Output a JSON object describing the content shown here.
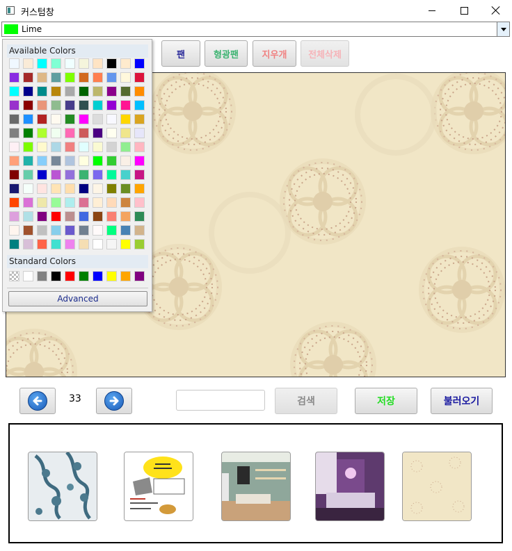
{
  "window": {
    "title": "커스텀창"
  },
  "color_combo": {
    "selected": "Lime",
    "swatch": "#00ff00"
  },
  "toolbar": {
    "pen": "팬",
    "highlighter": "형광팬",
    "eraser": "지우개",
    "clear_all": "전체삭제"
  },
  "color_picker": {
    "available_label": "Available Colors",
    "standard_label": "Standard Colors",
    "advanced_label": "Advanced",
    "available": [
      "#f0f8ff",
      "#faebd7",
      "#00ffff",
      "#7fffd4",
      "#f0ffff",
      "#f5f5dc",
      "#ffe4c4",
      "#000000",
      "#ffebcd",
      "#0000ff",
      "#8a2be2",
      "#a52a2a",
      "#deb887",
      "#5f9ea0",
      "#7fff00",
      "#d2691e",
      "#ff7f50",
      "#6495ed",
      "#fff8dc",
      "#dc143c",
      "#00ffff",
      "#00008b",
      "#008b8b",
      "#b8860b",
      "#a9a9a9",
      "#006400",
      "#bdb76b",
      "#8b008b",
      "#556b2f",
      "#ff8c00",
      "#9932cc",
      "#8b0000",
      "#e9967a",
      "#8fbc8f",
      "#483d8b",
      "#2f4f4f",
      "#00ced1",
      "#9400d3",
      "#ff1493",
      "#00bfff",
      "#696969",
      "#1e90ff",
      "#b22222",
      "#fffaf0",
      "#228b22",
      "#ff00ff",
      "#dcdcdc",
      "#f8f8ff",
      "#ffd700",
      "#daa520",
      "#808080",
      "#008000",
      "#adff2f",
      "#f0fff0",
      "#ff69b4",
      "#cd5c5c",
      "#4b0082",
      "#fffff0",
      "#f0e68c",
      "#e6e6fa",
      "#fff0f5",
      "#7cfc00",
      "#fffacd",
      "#add8e6",
      "#f08080",
      "#e0ffff",
      "#fafad2",
      "#d3d3d3",
      "#90ee90",
      "#ffb6c1",
      "#ffa07a",
      "#20b2aa",
      "#87cefa",
      "#778899",
      "#b0c4de",
      "#ffffe0",
      "#00ff00",
      "#32cd32",
      "#faf0e6",
      "#ff00ff",
      "#800000",
      "#66cdaa",
      "#0000cd",
      "#ba55d3",
      "#9370db",
      "#3cb371",
      "#7b68ee",
      "#00fa9a",
      "#48d1cc",
      "#c71585",
      "#191970",
      "#f5fffa",
      "#ffe4e1",
      "#ffe4b5",
      "#ffdead",
      "#000080",
      "#fdf5e6",
      "#808000",
      "#6b8e23",
      "#ffa500",
      "#ff4500",
      "#da70d6",
      "#eee8aa",
      "#98fb98",
      "#afeeee",
      "#db7093",
      "#ffefd5",
      "#ffdab9",
      "#cd853f",
      "#ffc0cb",
      "#dda0dd",
      "#b0e0e6",
      "#800080",
      "#ff0000",
      "#bc8f8f",
      "#4169e1",
      "#8b4513",
      "#fa8072",
      "#f4a460",
      "#2e8b57",
      "#fff5ee",
      "#a0522d",
      "#c0c0c0",
      "#87ceeb",
      "#6a5acd",
      "#708090",
      "#fffafa",
      "#00ff7f",
      "#4682b4",
      "#d2b48c",
      "#008080",
      "#d8bfd8",
      "#ff6347",
      "#40e0d0",
      "#ee82ee",
      "#f5deb3",
      "#ffffff",
      "#f5f5f5",
      "#ffff00",
      "#9acd32"
    ],
    "standard": [
      "transparent",
      "#ffffff",
      "#808080",
      "#000000",
      "#ff0000",
      "#008000",
      "#0000ff",
      "#ffff00",
      "#ffa500",
      "#800080"
    ]
  },
  "nav": {
    "page": "33",
    "search_label": "검색",
    "save_label": "저장",
    "load_label": "불러오기",
    "search_value": ""
  }
}
